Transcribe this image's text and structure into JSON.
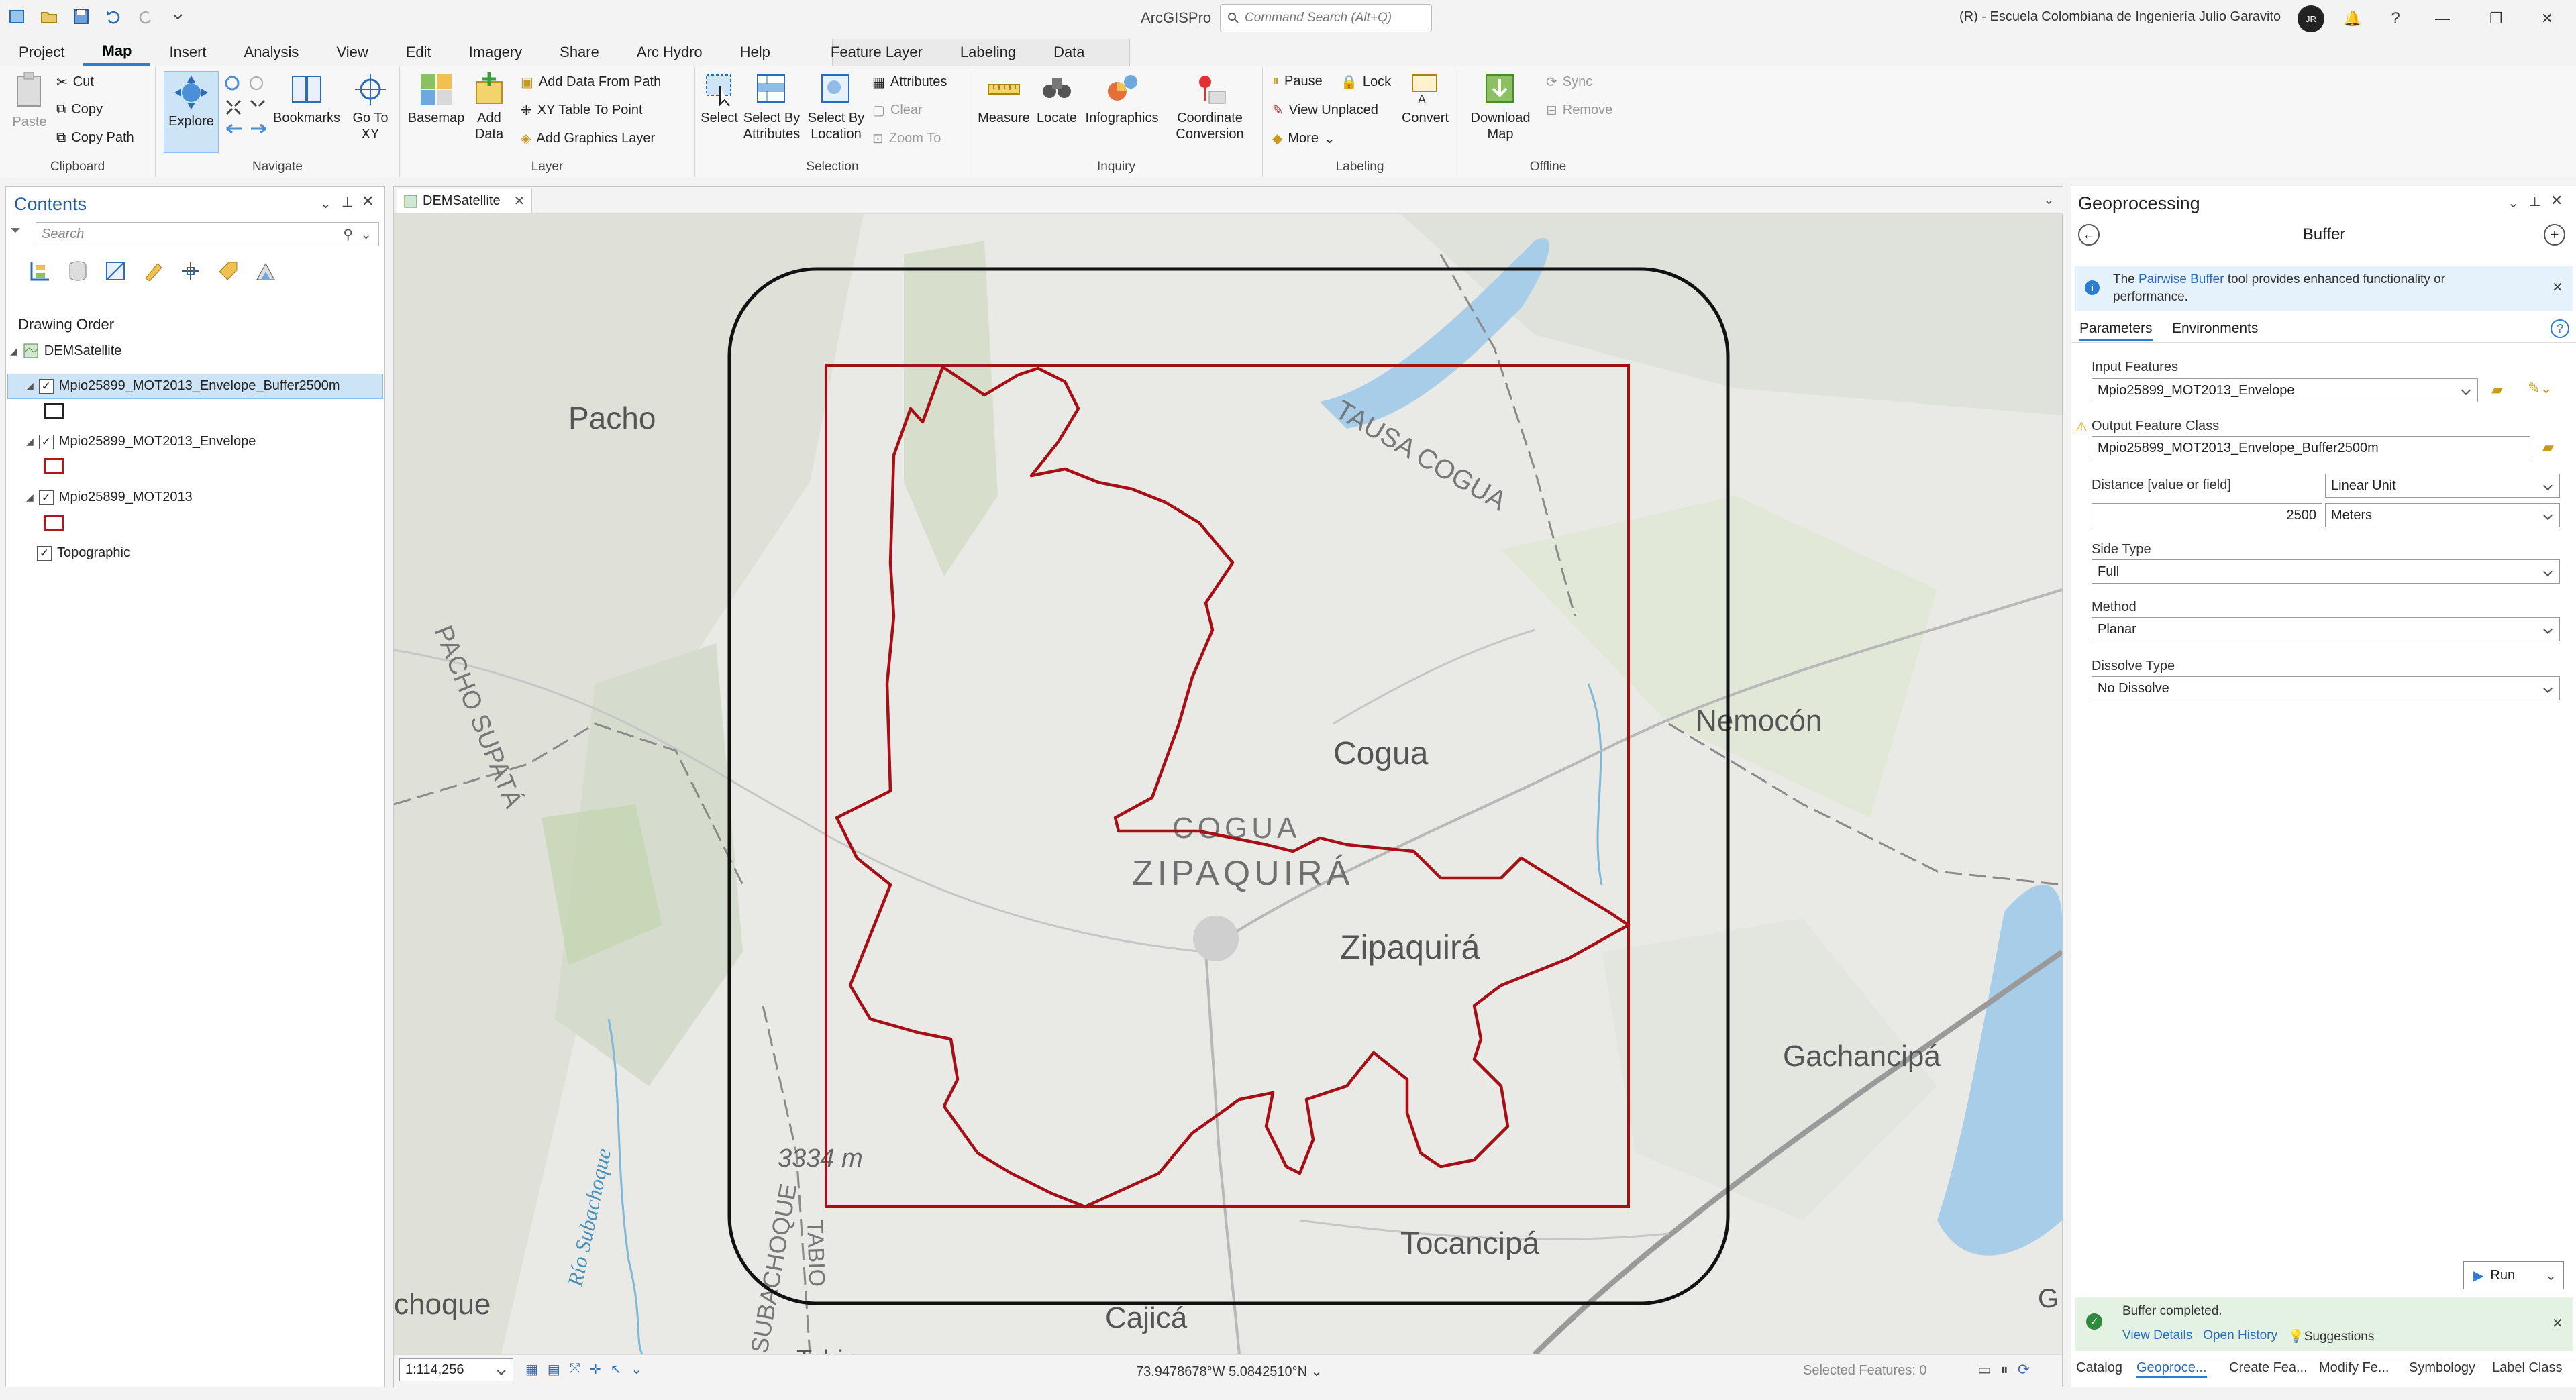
{
  "app": {
    "title": "ArcGISPro",
    "search_placeholder": "Command Search (Alt+Q)",
    "user": "(R) - Escuela Colombiana de Ingeniería Julio Garavito",
    "avatar": "JR"
  },
  "tabs": [
    "Project",
    "Map",
    "Insert",
    "Analysis",
    "View",
    "Edit",
    "Imagery",
    "Share",
    "Arc Hydro",
    "Help",
    "Feature Layer",
    "Labeling",
    "Data"
  ],
  "active_tab": "Map",
  "ribbon": {
    "clipboard": {
      "label": "Clipboard",
      "paste": "Paste",
      "cut": "Cut",
      "copy": "Copy",
      "copy_path": "Copy Path"
    },
    "navigate": {
      "label": "Navigate",
      "explore": "Explore",
      "bookmarks": "Bookmarks",
      "goto": "Go To XY"
    },
    "layer": {
      "label": "Layer",
      "basemap": "Basemap",
      "add_data": "Add Data",
      "add_path": "Add Data From Path",
      "xy_table": "XY Table To Point",
      "add_graphics": "Add Graphics Layer"
    },
    "selection": {
      "label": "Selection",
      "select": "Select",
      "by_attr": "Select By Attributes",
      "by_loc": "Select By Location",
      "attributes": "Attributes",
      "clear": "Clear",
      "zoom_to": "Zoom To"
    },
    "inquiry": {
      "label": "Inquiry",
      "measure": "Measure",
      "locate": "Locate",
      "infographics": "Infographics",
      "coord": "Coordinate Conversion"
    },
    "labeling": {
      "label": "Labeling",
      "pause": "Pause",
      "lock": "Lock",
      "view_unplaced": "View Unplaced",
      "more": "More",
      "convert": "Convert"
    },
    "offline": {
      "label": "Offline",
      "download": "Download Map",
      "sync": "Sync",
      "remove": "Remove"
    }
  },
  "contents": {
    "title": "Contents",
    "search_placeholder": "Search",
    "drawing_order": "Drawing Order",
    "map_name": "DEMSatellite",
    "layers": [
      {
        "name": "Mpio25899_MOT2013_Envelope_Buffer2500m",
        "checked": true,
        "selected": true,
        "symbol": "#222222"
      },
      {
        "name": "Mpio25899_MOT2013_Envelope",
        "checked": true,
        "selected": false,
        "symbol": "#b01818"
      },
      {
        "name": "Mpio25899_MOT2013",
        "checked": true,
        "selected": false,
        "symbol": "#b01818"
      }
    ],
    "basemap": "Topographic"
  },
  "map": {
    "tab": "DEMSatellite",
    "scale": "1:114,256",
    "coords": "73.9478678°W 5.0842510°N",
    "selected_features": "Selected Features: 0",
    "labels": {
      "pacho": "Pacho",
      "pacho_supata": "PACHO SUPATÁ",
      "tausa_cogua": "TAUSA COGUA",
      "cogua": "Cogua",
      "cogua_caps": "COGUA",
      "zipaquira_caps": "ZIPAQUIRÁ",
      "zipaquira": "Zipaquirá",
      "nemocon": "Nemocón",
      "gachancipa": "Gachancipá",
      "tocancipa": "Tocancipá",
      "cajica": "Cajicá",
      "choque": "choque",
      "rio": "Río Subachoque",
      "subachoque": "SUBACHOQUE",
      "elevation": "3334 m",
      "tabio": "TABIO",
      "tabio2": "Tabio",
      "g": "G"
    }
  },
  "geoprocessing": {
    "title": "Geoprocessing",
    "tool": "Buffer",
    "info_prefix": "The",
    "info_link": "Pairwise Buffer",
    "info_suffix": "tool provides enhanced functionality or performance.",
    "tab_params": "Parameters",
    "tab_env": "Environments",
    "input_label": "Input Features",
    "input_value": "Mpio25899_MOT2013_Envelope",
    "output_label": "Output Feature Class",
    "output_value": "Mpio25899_MOT2013_Envelope_Buffer2500m",
    "distance_label": "Distance [value or field]",
    "distance_type": "Linear Unit",
    "distance_value": "2500",
    "distance_unit": "Meters",
    "side_label": "Side Type",
    "side_value": "Full",
    "method_label": "Method",
    "method_value": "Planar",
    "dissolve_label": "Dissolve Type",
    "dissolve_value": "No Dissolve",
    "run": "Run",
    "status": "Buffer completed.",
    "view_details": "View Details",
    "open_history": "Open History",
    "suggestions": "Suggestions"
  },
  "bottom_tabs": [
    "Catalog",
    "Geoproce...",
    "Create Fea...",
    "Modify Fe...",
    "Symbology",
    "Label Class"
  ],
  "colors": {
    "accent": "#2b7cd3",
    "boundary": "#a50f15",
    "buffer": "#111111",
    "info_bg": "#e5f1fb",
    "success_bg": "#e4f2e4"
  }
}
